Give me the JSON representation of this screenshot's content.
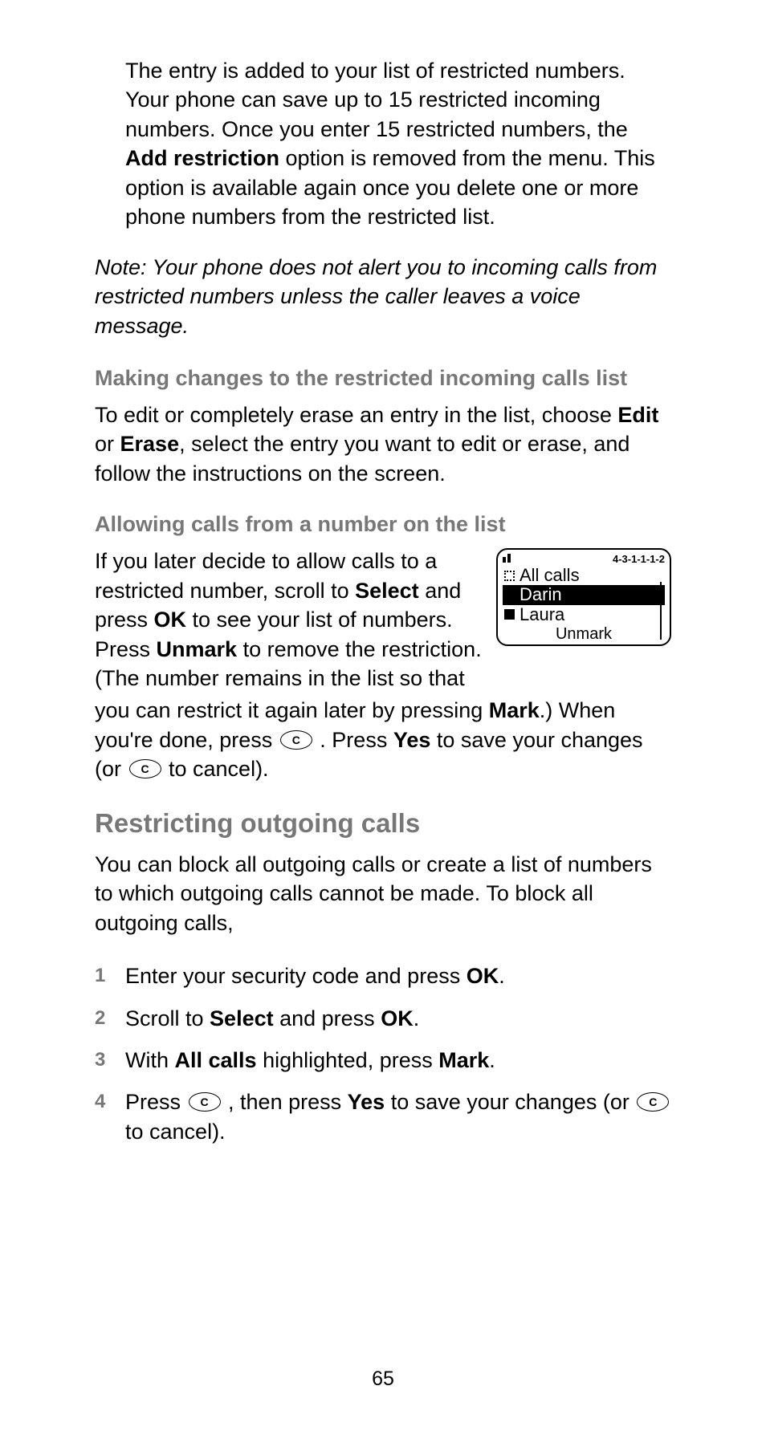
{
  "para1_text": "The entry is added to your list of restricted numbers. Your phone can save up to 15 restricted incoming numbers. Once you enter 15 restricted numbers, the ",
  "para1_bold": "Add restriction",
  "para1_text2": " option is removed from the menu. This option is available again once you delete one or more phone numbers from the restricted list.",
  "note": "Note: Your phone does not alert you to incoming calls from restricted numbers unless the caller leaves a voice message.",
  "sub1": "Making changes to the restricted incoming calls list",
  "p2a": "To edit or completely erase an entry in the list, choose ",
  "p2_edit": "Edit",
  "p2b": " or ",
  "p2_erase": "Erase",
  "p2c": ", select the entry you want to edit or erase, and follow the instructions on the screen.",
  "sub2": "Allowing calls from a number on the list",
  "p3a": "If you later decide to allow calls to a restricted number, scroll to ",
  "p3_select": "Select",
  "p3b": " and press ",
  "p3_ok": "OK",
  "p3c": " to see your list of numbers. Press ",
  "p3_unmark": "Unmark",
  "p3d": " to remove the restriction. (The number remains in the list so that",
  "p3e": "you can restrict it again later by pressing ",
  "p3_mark": "Mark",
  "p3f": ".) When you're done, press ",
  "ckey": "C",
  "p3g": " . Press ",
  "p3_yes": "Yes",
  "p3h": " to save your changes (or ",
  "p3i": " to cancel).",
  "phone": {
    "code": "4-3-1-1-1-2",
    "row1": "All calls",
    "row2": "Darin",
    "row3": "Laura",
    "softkey": "Unmark"
  },
  "section": "Restricting outgoing calls",
  "p4": "You can block all outgoing calls or create a list of numbers to which outgoing calls cannot be made. To block all outgoing calls,",
  "steps": {
    "s1a": "Enter your security code and press ",
    "s1_ok": "OK",
    "s1b": ".",
    "s2a": "Scroll to ",
    "s2_select": "Select",
    "s2b": " and press ",
    "s2_ok": "OK",
    "s2c": ".",
    "s3a": "With ",
    "s3_all": "All calls",
    "s3b": " highlighted, press ",
    "s3_mark": "Mark",
    "s3c": ".",
    "s4a": "Press ",
    "s4b": " , then press ",
    "s4_yes": "Yes",
    "s4c": " to save your changes (or ",
    "s4d": " to cancel)."
  },
  "page_number": "65"
}
